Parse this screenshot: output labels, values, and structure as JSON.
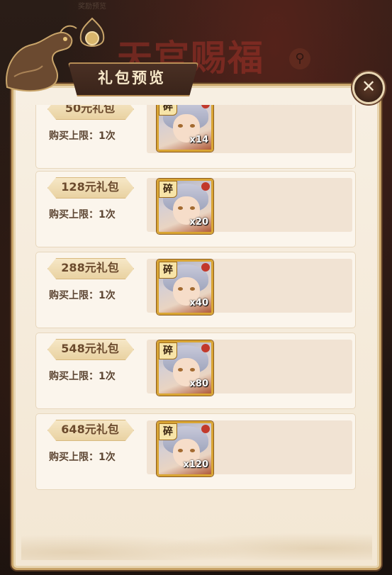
{
  "background": {
    "title": "天官赐福",
    "top_text": "奖励预览"
  },
  "popup": {
    "title": "礼包预览",
    "close_symbol": "✕"
  },
  "colors": {
    "frame_gold": "#c9a56a",
    "title_banner": "#3a241a",
    "card_bg": "#fbf5ec",
    "item_border": "#d9a534"
  },
  "item": {
    "name_icon": "fragment-icon",
    "badge": "碎"
  },
  "packs": [
    {
      "price": "50元礼包",
      "limit": "购买上限：1次",
      "qty": "x14"
    },
    {
      "price": "128元礼包",
      "limit": "购买上限：1次",
      "qty": "x20"
    },
    {
      "price": "288元礼包",
      "limit": "购买上限：1次",
      "qty": "x40"
    },
    {
      "price": "548元礼包",
      "limit": "购买上限：1次",
      "qty": "x80"
    },
    {
      "price": "648元礼包",
      "limit": "购买上限：1次",
      "qty": "x120"
    }
  ]
}
